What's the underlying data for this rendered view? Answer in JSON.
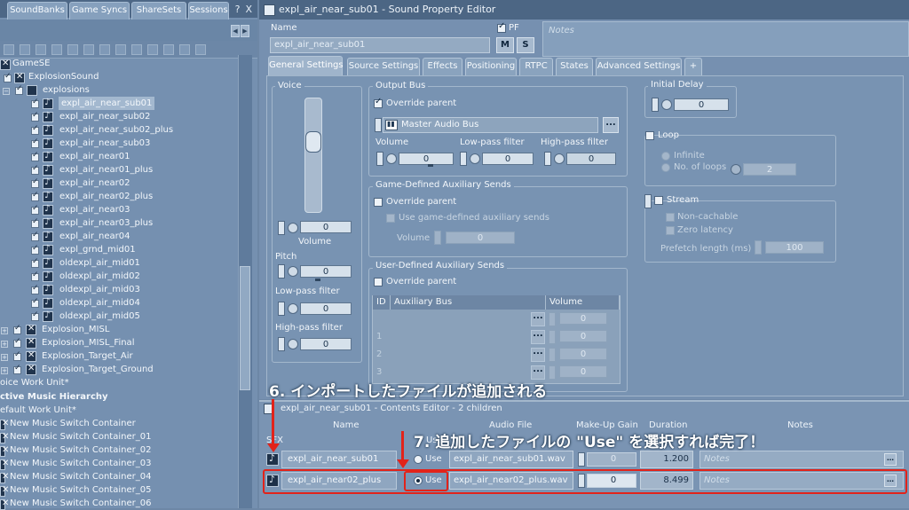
{
  "left_panel": {
    "title_buttons": [
      "-",
      "?",
      "X"
    ],
    "tabs": [
      "SoundBanks",
      "Game Syncs",
      "ShareSets",
      "Sessions"
    ],
    "tree": {
      "root": "GameSE",
      "work_unit": "ExplosionSound",
      "folder": "explosions",
      "sounds": [
        "expl_air_near_sub01",
        "expl_air_near_sub02",
        "expl_air_near_sub02_plus",
        "expl_air_near_sub03",
        "expl_air_near01",
        "expl_air_near01_plus",
        "expl_air_near02",
        "expl_air_near02_plus",
        "expl_air_near03",
        "expl_air_near03_plus",
        "expl_air_near04",
        "expl_grnd_mid01",
        "oldexpl_air_mid01",
        "oldexpl_air_mid02",
        "oldexpl_air_mid03",
        "oldexpl_air_mid04",
        "oldexpl_air_mid05"
      ],
      "other_containers": [
        "Explosion_MISL",
        "Explosion_MISL_Final",
        "Explosion_Target_Air",
        "Explosion_Target_Ground"
      ],
      "voice_work_unit": "oice Work Unit*",
      "music_hierarchy": "ctive Music Hierarchy",
      "default_work_unit": "efault Work Unit*",
      "music_containers": [
        "New Music Switch Container",
        "New Music Switch Container_01",
        "New Music Switch Container_02",
        "New Music Switch Container_03",
        "New Music Switch Container_04",
        "New Music Switch Container_05",
        "New Music Switch Container_06"
      ]
    }
  },
  "property_editor": {
    "title": "expl_air_near_sub01 - Sound Property Editor",
    "name_label": "Name",
    "name_value": "expl_air_near_sub01",
    "pf_label": "PF",
    "m_label": "M",
    "s_label": "S",
    "notes_placeholder": "Notes",
    "tabs": [
      "General Settings",
      "Source Settings",
      "Effects",
      "Positioning",
      "RTPC",
      "States",
      "Advanced Settings",
      "+"
    ],
    "voice": {
      "title": "Voice",
      "volume_value": "0",
      "volume_label": "Volume",
      "pitch_label": "Pitch",
      "pitch_value": "0",
      "lowpass_label": "Low-pass filter",
      "lowpass_value": "0",
      "highpass_label": "High-pass filter",
      "highpass_value": "0"
    },
    "output_bus": {
      "title": "Output Bus",
      "override": "Override parent",
      "bus_name": "Master Audio Bus",
      "browse": "...",
      "volume_label": "Volume",
      "volume_value": "0",
      "lowpass_label": "Low-pass filter",
      "lowpass_value": "0",
      "highpass_label": "High-pass filter",
      "highpass_value": "0"
    },
    "game_aux": {
      "title": "Game-Defined Auxiliary Sends",
      "override": "Override parent",
      "use_game": "Use game-defined auxiliary sends",
      "volume_label": "Volume",
      "volume_value": "0"
    },
    "user_aux": {
      "title": "User-Defined Auxiliary Sends",
      "override": "Override parent",
      "col_id": "ID",
      "col_bus": "Auxiliary Bus",
      "col_volume": "Volume",
      "rows": [
        {
          "id": "",
          "value": "0"
        },
        {
          "id": "1",
          "value": "0"
        },
        {
          "id": "2",
          "value": "0"
        },
        {
          "id": "3",
          "value": "0"
        }
      ]
    },
    "initial_delay": {
      "title": "Initial Delay",
      "value": "0"
    },
    "loop": {
      "title": "Loop",
      "infinite": "Infinite",
      "no_loops": "No. of loops",
      "loops_value": "2"
    },
    "stream": {
      "title": "Stream",
      "non_cachable": "Non-cachable",
      "zero_latency": "Zero latency",
      "prefetch_label": "Prefetch length (ms)",
      "prefetch_value": "100"
    }
  },
  "contents_editor": {
    "title": "expl_air_near_sub01 - Contents Editor - 2 children",
    "col_name": "Name",
    "col_audio": "Audio File",
    "col_makeup": "Make-Up Gain",
    "col_duration": "Duration",
    "col_notes": "Notes",
    "sfx_label": "SFX",
    "use_header": "Use",
    "rows": [
      {
        "name": "expl_air_near_sub01",
        "use": "Use",
        "file": "expl_air_near_sub01.wav",
        "gain": "0",
        "duration": "1.200",
        "notes": "Notes"
      },
      {
        "name": "expl_air_near02_plus",
        "use": "Use",
        "file": "expl_air_near02_plus.wav",
        "gain": "0",
        "duration": "8.499",
        "notes": "Notes"
      }
    ]
  },
  "annotations": {
    "step6": "6. インポートしたファイルが追加される",
    "step7": "7. 追加したファイルの \"Use\" を選択すれば完了！"
  },
  "colors": {
    "annotation_red": "#e2231a",
    "panel_bg": "#7690b0",
    "title_bar": "#4c6684"
  }
}
